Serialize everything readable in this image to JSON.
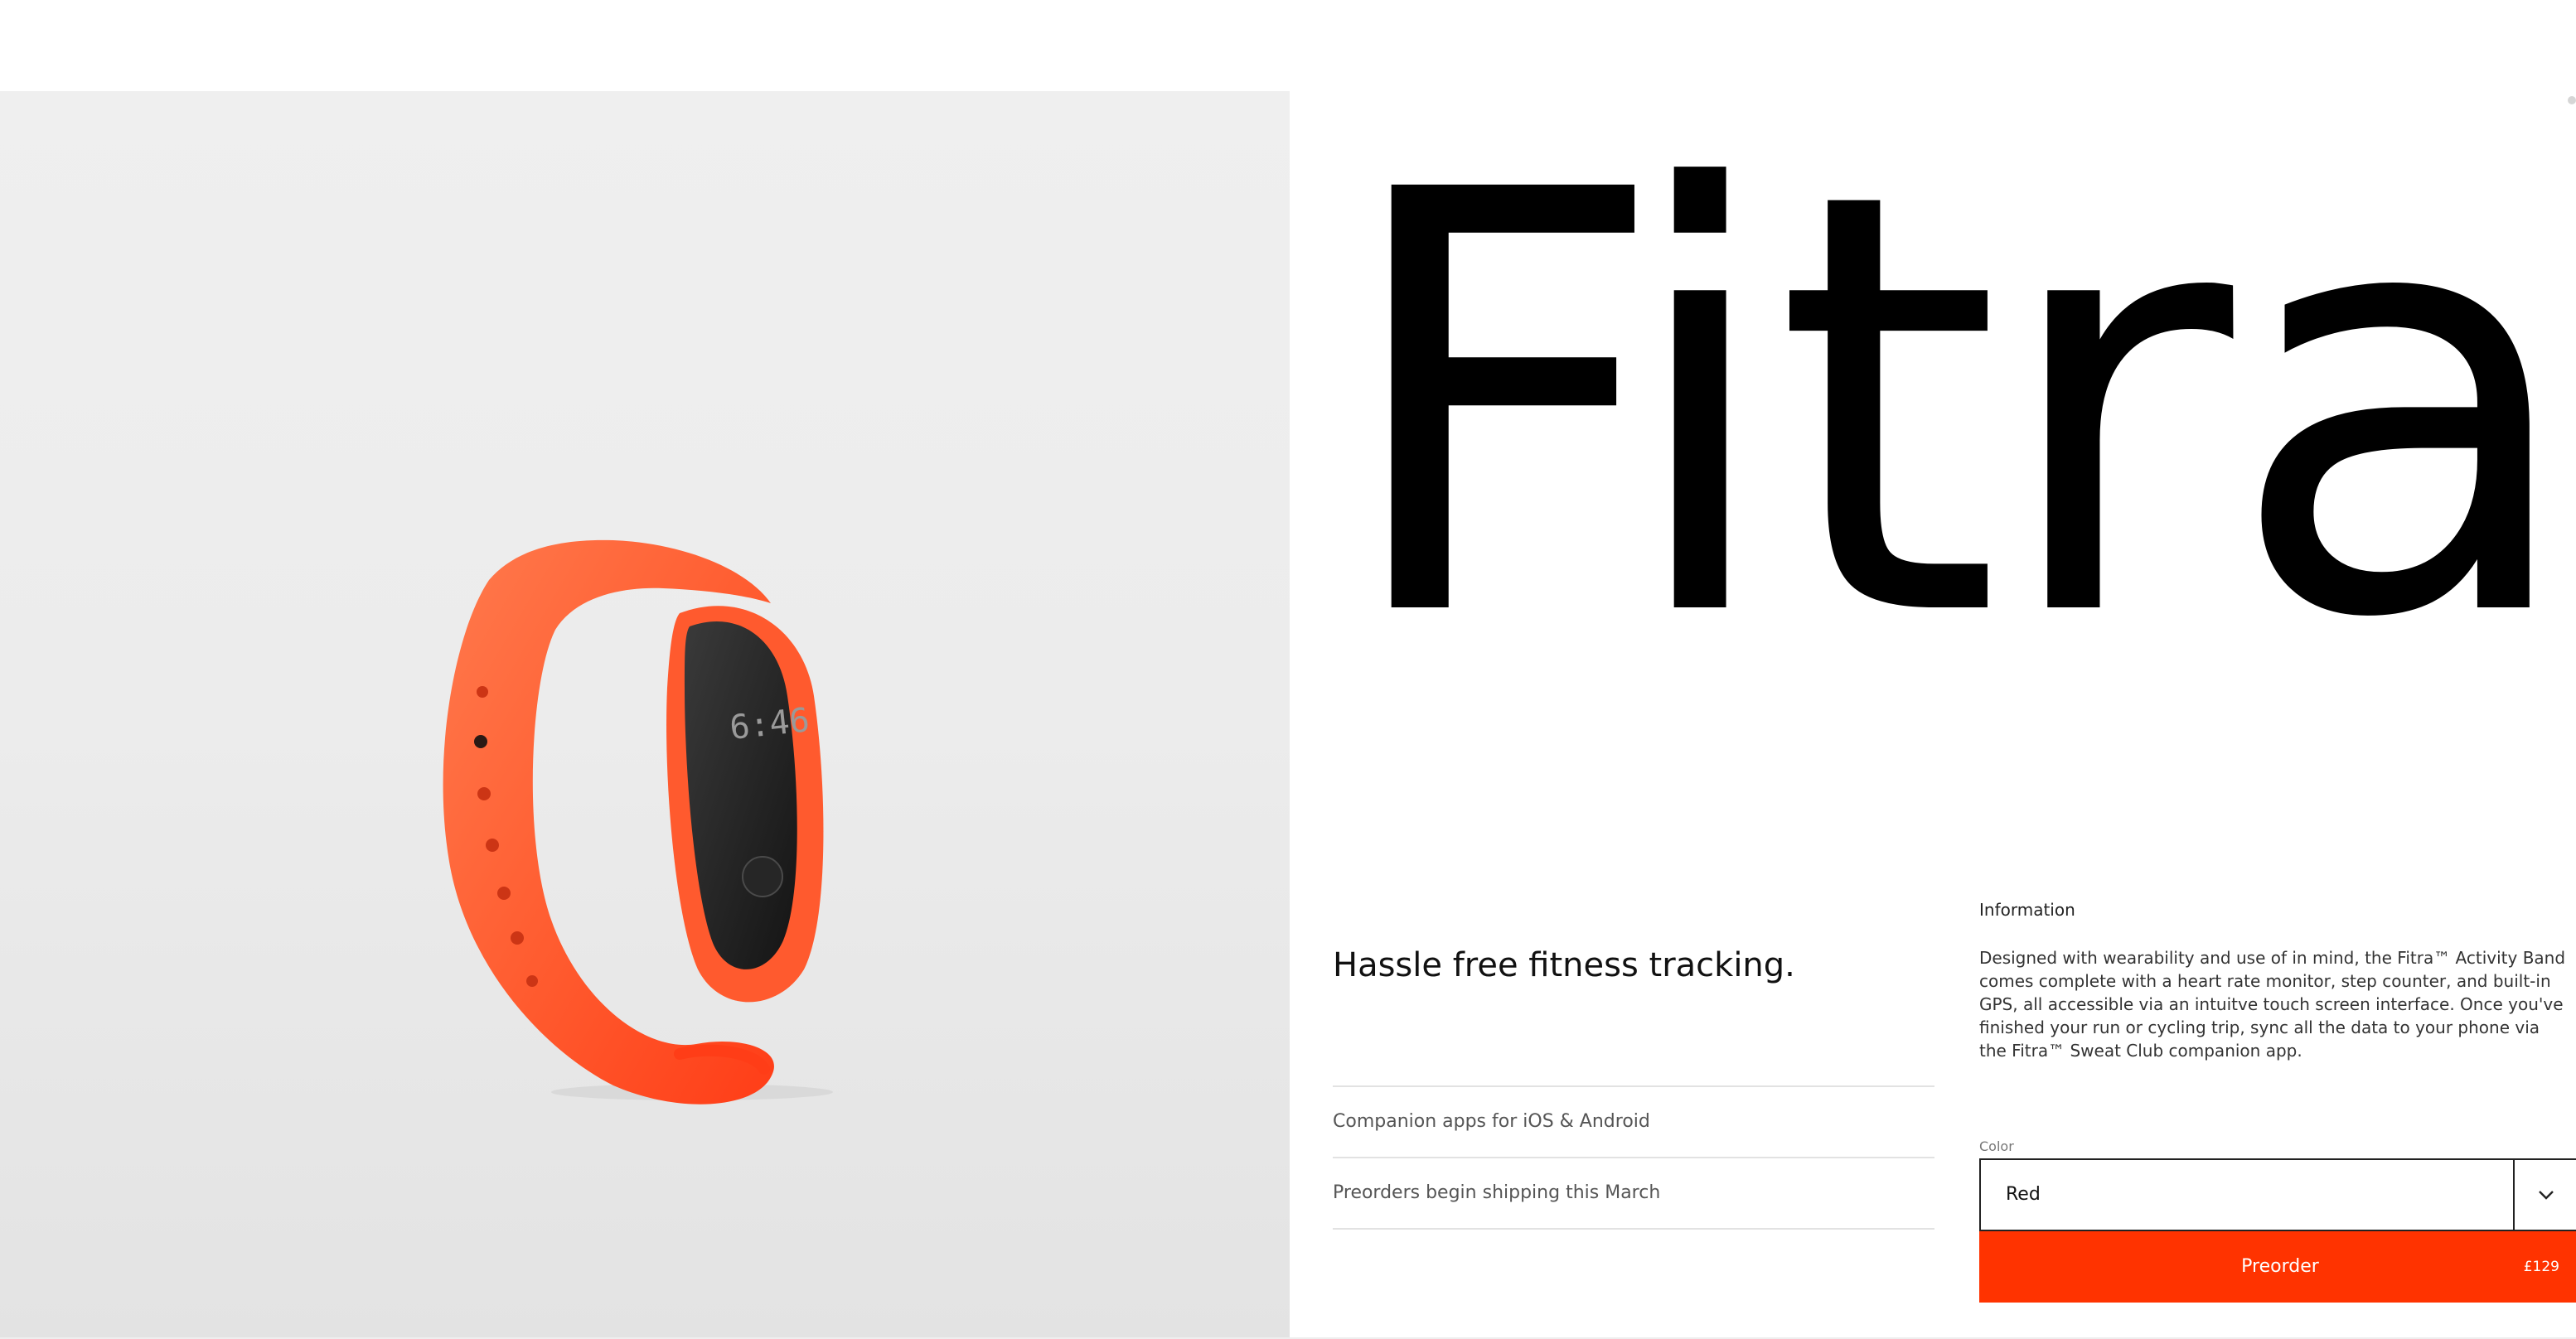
{
  "product": {
    "name": "Fitra",
    "tagline": "Hassle free fitness tracking.",
    "display_time": "6:46",
    "features": [
      "Companion apps for iOS & Android",
      "Preorders begin shipping this March"
    ]
  },
  "information": {
    "heading": "Information",
    "body": "Designed with wearability and use of in mind, the Fitra™ Activity Band comes complete with a heart rate monitor, step counter, and built-in GPS, all accessible via an intuitve touch screen interface. Once you've finished your run or cycling trip, sync all the data to your phone via the Fitra™ Sweat Club companion app."
  },
  "purchase": {
    "color_label": "Color",
    "color_value": "Red",
    "preorder_label": "Preorder",
    "price": "£129"
  },
  "colors": {
    "accent": "#ff3300",
    "band": "#ff5a2e",
    "image_background": "#ededed"
  },
  "icons": {
    "select_arrow": "chevron-down-icon"
  }
}
